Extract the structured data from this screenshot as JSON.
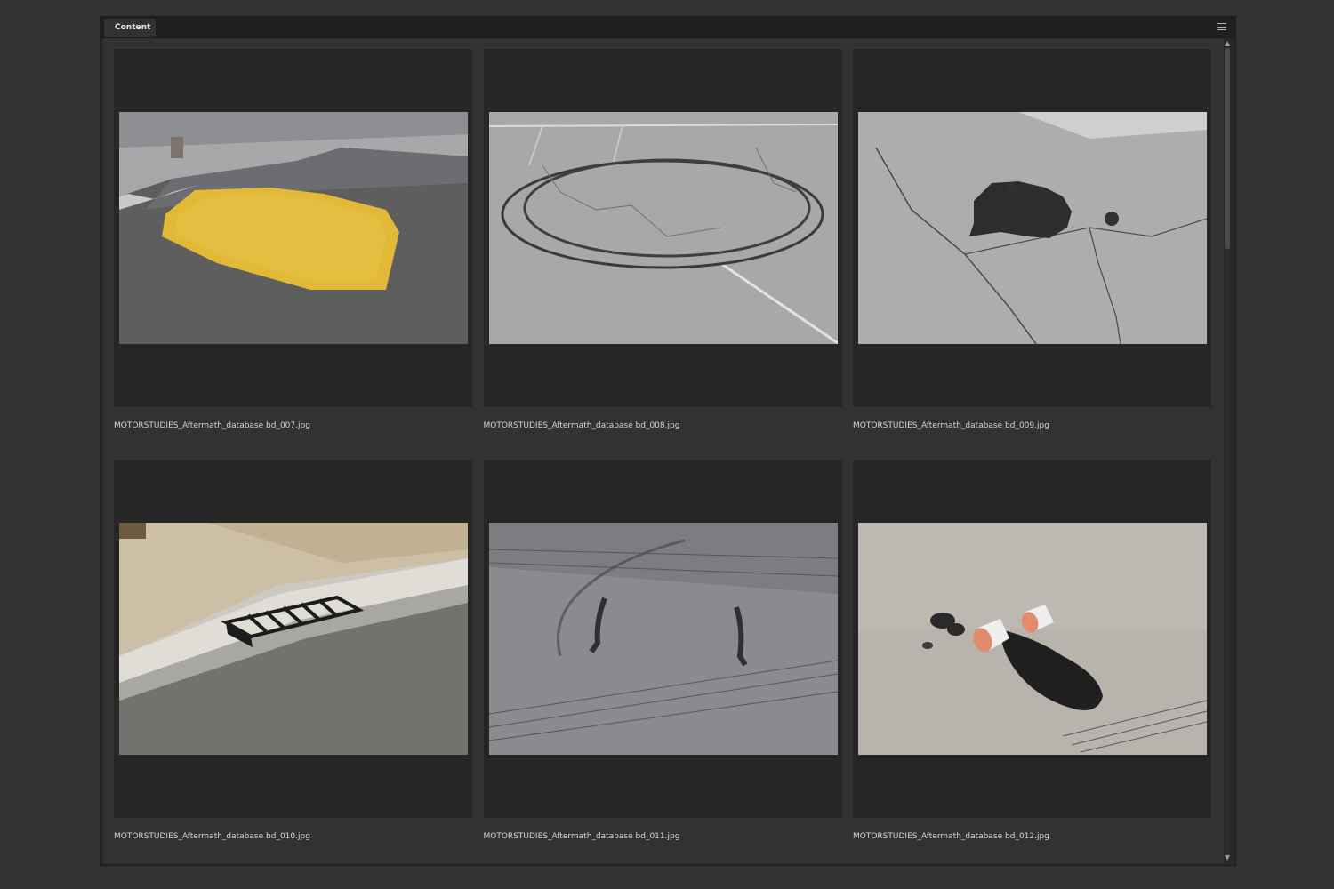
{
  "panel": {
    "tab_label": "Content",
    "menu_icon": "panel-menu-icon"
  },
  "items": [
    {
      "filename": "MOTORSTUDIES_Aftermath_database bd_007.jpg",
      "subject": "yellow paint patch on asphalt near curb"
    },
    {
      "filename": "MOTORSTUDIES_Aftermath_database bd_008.jpg",
      "subject": "circular tire marks on parking lot"
    },
    {
      "filename": "MOTORSTUDIES_Aftermath_database bd_009.jpg",
      "subject": "dark oil stain on cracked asphalt"
    },
    {
      "filename": "MOTORSTUDIES_Aftermath_database bd_010.jpg",
      "subject": "storm drain grate at curb"
    },
    {
      "filename": "MOTORSTUDIES_Aftermath_database bd_011.jpg",
      "subject": "skid marks on gray road"
    },
    {
      "filename": "MOTORSTUDIES_Aftermath_database bd_012.jpg",
      "subject": "two spilled cups on pavement"
    }
  ],
  "scrollbar": {
    "position": 0.0,
    "visible_fraction": 0.25
  }
}
